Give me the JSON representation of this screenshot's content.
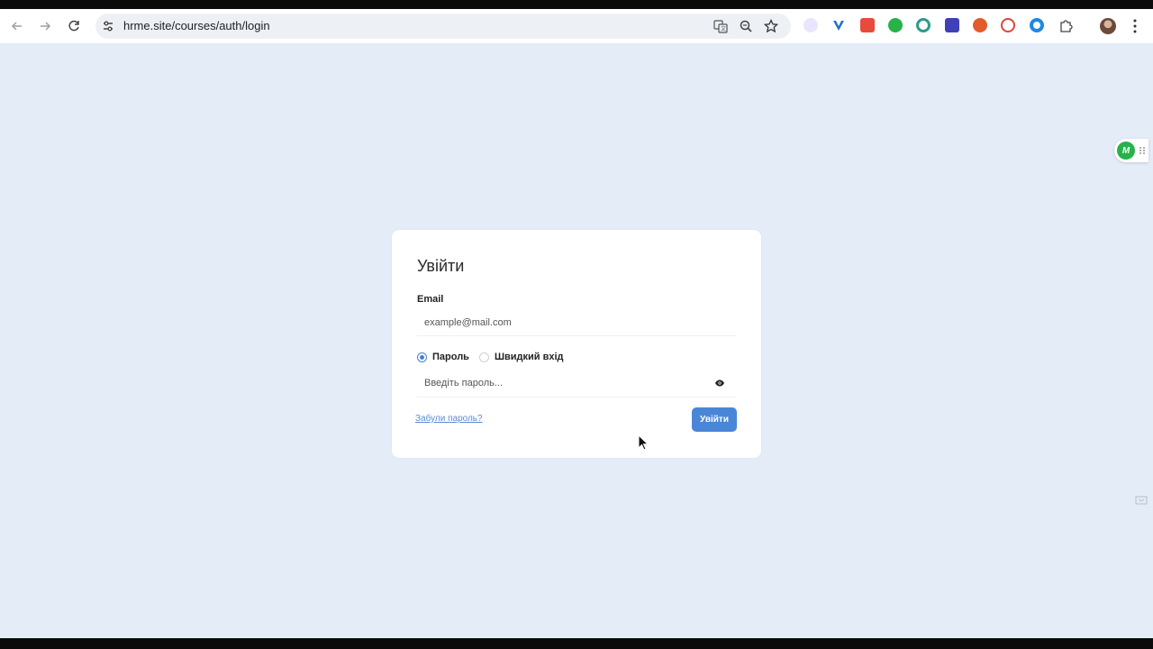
{
  "browser": {
    "url": "hrme.site/courses/auth/login"
  },
  "login": {
    "title": "Увійти",
    "email_label": "Email",
    "email_placeholder": "example@mail.com",
    "radio_password": "Пароль",
    "radio_quick": "Швидкий вхід",
    "password_placeholder": "Введіть пароль...",
    "forgot_link": "Забули пароль?",
    "submit_label": "Увійти",
    "selected_mode": "Пароль"
  },
  "widget": {
    "logo_text": "M"
  },
  "colors": {
    "page_bg": "#e4ecf8",
    "accent": "#4a86d8",
    "link": "#5b8ad6"
  }
}
